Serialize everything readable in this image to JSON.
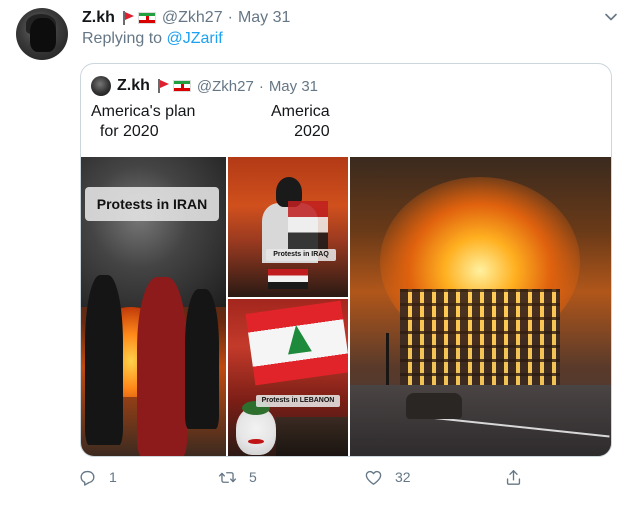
{
  "tweet": {
    "author_name": "Z.kh",
    "author_handle": "@Zkh27",
    "separator": "·",
    "date": "May 31",
    "reply_prefix": "Replying to",
    "reply_to": "@JZarif"
  },
  "quoted": {
    "author_name": "Z.kh",
    "author_handle": "@Zkh27",
    "separator": "·",
    "date": "May 31",
    "text_left": "America's plan\n  for 2020",
    "text_right": "America\n 2020",
    "media": {
      "iran_label": "Protests in IRAN",
      "iraq_label": "Protests in IRAQ",
      "lebanon_label": "Protests in LEBANON"
    }
  },
  "actions": {
    "reply_count": "1",
    "retweet_count": "5",
    "like_count": "32",
    "icons": [
      "reply-icon",
      "retweet-icon",
      "like-icon",
      "share-icon"
    ]
  },
  "colors": {
    "link": "#1da1f2",
    "muted": "#657786",
    "border": "#ccd6dd"
  }
}
